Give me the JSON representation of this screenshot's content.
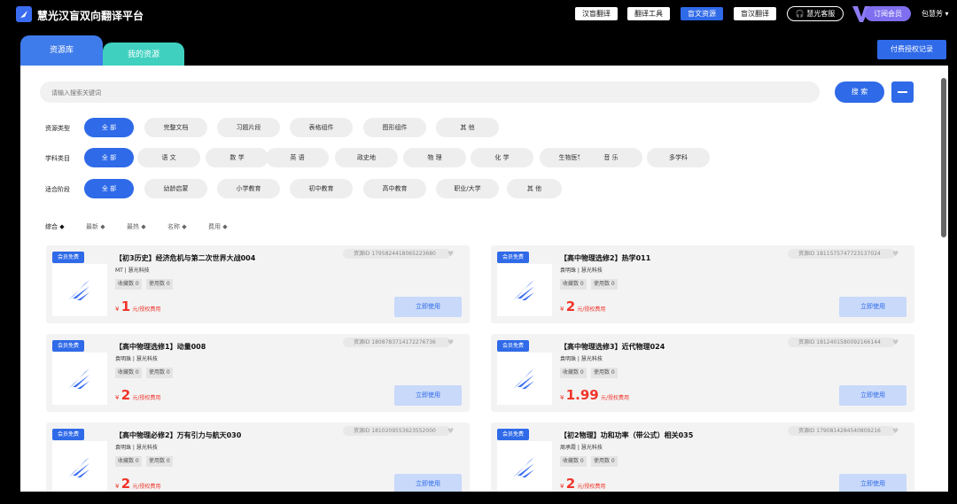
{
  "app": {
    "title": "慧光汉盲双向翻译平台"
  },
  "topnav": [
    {
      "label": "汉盲翻译",
      "active": false
    },
    {
      "label": "翻译工具",
      "active": false
    },
    {
      "label": "盲文资源",
      "active": true
    },
    {
      "label": "盲汉翻译",
      "active": false
    }
  ],
  "header": {
    "service_label": "慧光客服",
    "subscribe_label": "订阅会员",
    "username": "包慧芳 ▾"
  },
  "tabs": [
    {
      "label": "资源库",
      "active": true
    },
    {
      "label": "我的资源",
      "active": false
    }
  ],
  "license_button": "付费授权记录",
  "search": {
    "placeholder": "请输入搜索关键词",
    "button": "搜 索"
  },
  "filters": [
    {
      "label": "资源类型",
      "options": [
        "全 部",
        "完整文档",
        "习题片段",
        "表格组件",
        "图形组件",
        "其 他"
      ]
    },
    {
      "label": "学科类目",
      "options": [
        "全 部",
        "语 文",
        "数 学",
        "英 语",
        "政史地",
        "物 理",
        "化 学",
        "生物医学",
        "音 乐",
        "多学科"
      ]
    },
    {
      "label": "适合阶段",
      "options": [
        "全 部",
        "幼龄启蒙",
        "小学教育",
        "初中教育",
        "高中教育",
        "职业/大学",
        "其 他"
      ]
    }
  ],
  "sort": [
    "综合 ◆",
    "最新 ◆",
    "最热 ◆",
    "名称 ◆",
    "费用 ◆"
  ],
  "card_common": {
    "badge": "会员免费",
    "use_button": "立即使用",
    "currency": "¥",
    "unit": "元/授权费用",
    "id_prefix": "资源ID",
    "fav_prefix": "收藏数",
    "use_prefix": "使用数"
  },
  "cards": [
    {
      "title": "【初3历史】经济危机与第二次世界大战004",
      "meta": "MT | 慧光科技",
      "favorites": "收藏数 0",
      "uses": "使用数 0",
      "price": "1",
      "resource_id": "资源ID  1795824418065223680"
    },
    {
      "title": "【高中物理选修2】热学011",
      "meta": "袁明珠 | 慧光科技",
      "favorites": "收藏数 0",
      "uses": "使用数 0",
      "price": "2",
      "resource_id": "资源ID  1811575747723137024"
    },
    {
      "title": "【高中物理选修1】动量008",
      "meta": "袁明珠 | 慧光科技",
      "favorites": "收藏数 0",
      "uses": "使用数 0",
      "price": "2",
      "resource_id": "资源ID  1808783714172276736"
    },
    {
      "title": "【高中物理选修3】近代物理024",
      "meta": "袁明珠 | 慧光科技",
      "favorites": "收藏数 0",
      "uses": "使用数 0",
      "price": "1.99",
      "resource_id": "资源ID  1812401580092166144"
    },
    {
      "title": "【高中物理必修2】万有引力与航天030",
      "meta": "袁明珠 | 慧光科技",
      "favorites": "收藏数 0",
      "uses": "使用数 0",
      "price": "2",
      "resource_id": "资源ID  1810209553623552000"
    },
    {
      "title": "【初2物理】功和功率（带公式）相关035",
      "meta": "周承霞 | 慧光科技",
      "favorites": "收藏数 0",
      "uses": "使用数 0",
      "price": "2",
      "resource_id": "资源ID  1790814284540809216"
    }
  ],
  "colors": {
    "accent": "#2f6ae8",
    "tab_secondary": "#3fd0c0",
    "price": "#f0352b",
    "vip": "#7f6ff0"
  }
}
